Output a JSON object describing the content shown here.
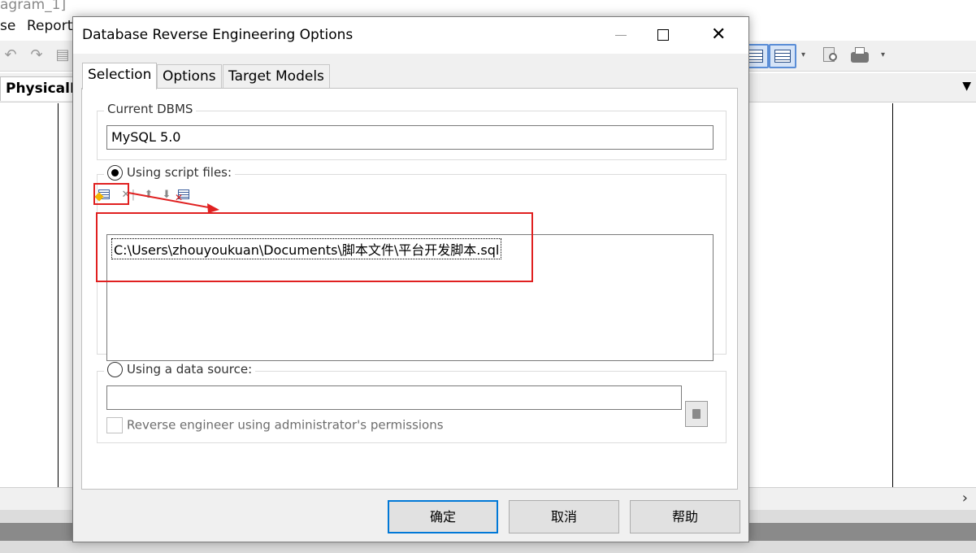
{
  "background_app": {
    "title_fragment": "agram_1]",
    "menu": [
      "se",
      "Report"
    ],
    "diagram_tab": "PhysicalD",
    "tab_menu_glyph": "▼",
    "scroll_right_glyph": "›"
  },
  "dialog": {
    "title": "Database Reverse Engineering Options",
    "window_buttons": {
      "minimize": "",
      "maximize": "",
      "close": "✕"
    },
    "tabs": [
      {
        "label": "Selection",
        "active": true
      },
      {
        "label": "Options",
        "active": false
      },
      {
        "label": "Target Models",
        "active": false
      }
    ],
    "current_dbms": {
      "legend": "Current DBMS",
      "value": "MySQL 5.0"
    },
    "script_files": {
      "label": "Using script files:",
      "selected": true,
      "toolbar_icons": [
        "add-file-icon",
        "delete-icon",
        "move-up-icon",
        "move-down-icon",
        "remove-file-icon"
      ],
      "files": [
        "C:\\Users\\zhouyoukuan\\Documents\\脚本文件\\平台开发脚本.sql"
      ]
    },
    "data_source": {
      "label": "Using a data source:",
      "selected": false,
      "value": "",
      "admin_checkbox_label": "Reverse engineer using administrator's permissions",
      "admin_checked": false
    },
    "buttons": {
      "ok": "确定",
      "cancel": "取消",
      "help": "帮助"
    }
  },
  "colors": {
    "annotation_red": "#e02020",
    "default_button_border": "#0078d7",
    "dialog_bg": "#f0f0f0"
  }
}
